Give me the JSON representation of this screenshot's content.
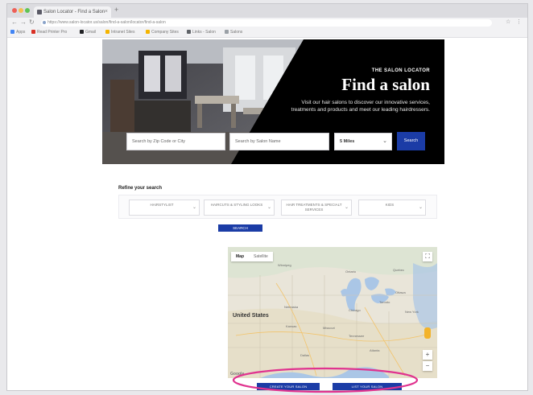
{
  "colors": {
    "accent": "#1b3ca6",
    "hero_bg": "#000000",
    "annotation": "#e0338f"
  },
  "browser": {
    "tab_title": "Salon Locator - Find a Salon",
    "tab_close": "×",
    "new_tab": "+",
    "url": "https://www.salon-locator.us/salon/find-a-salon/locator/find-a-salon",
    "nav": {
      "back": "←",
      "forward": "→",
      "reload": "↻"
    },
    "bookmarks": [
      "Apps",
      "Read Printer Pro",
      "Gmail",
      "Intranet Sites",
      "Company Sites",
      "Links - Salon",
      "Salons"
    ]
  },
  "hero": {
    "eyebrow": "THE SALON LOCATOR",
    "title": "Find a salon",
    "description": "Visit our hair salons to discover our innovative services, treatments and products and meet our leading hairdressers.",
    "location_placeholder": "Search by Zip Code or City",
    "name_placeholder": "Search by Salon Name",
    "radius_value": "5 Miles",
    "search_label": "Search"
  },
  "refine": {
    "heading": "Refine your search",
    "filters": [
      "HAIRSTYLIST",
      "HAIRCUTS & STYLING LOOKS",
      "HAIR TREATMENTS & SPECIALT SERVICES",
      "KIDS"
    ],
    "search_label": "SEARCH"
  },
  "map": {
    "toggle_map": "Map",
    "toggle_satellite": "Satellite",
    "fullscreen": "⛶",
    "zoom_in": "+",
    "zoom_out": "−",
    "country_label": "United States",
    "place_labels": [
      "Winnipeg",
      "Ontario",
      "Quebec",
      "Ottawa",
      "Toronto",
      "Chicago",
      "New York",
      "Nebraska",
      "Kansas",
      "Missouri",
      "Tennessee",
      "Atlanta",
      "Dallas"
    ],
    "brand": "Google"
  },
  "actions": {
    "create_label": "CREATE YOUR SALON",
    "list_label": "LIST YOUR SALON"
  }
}
